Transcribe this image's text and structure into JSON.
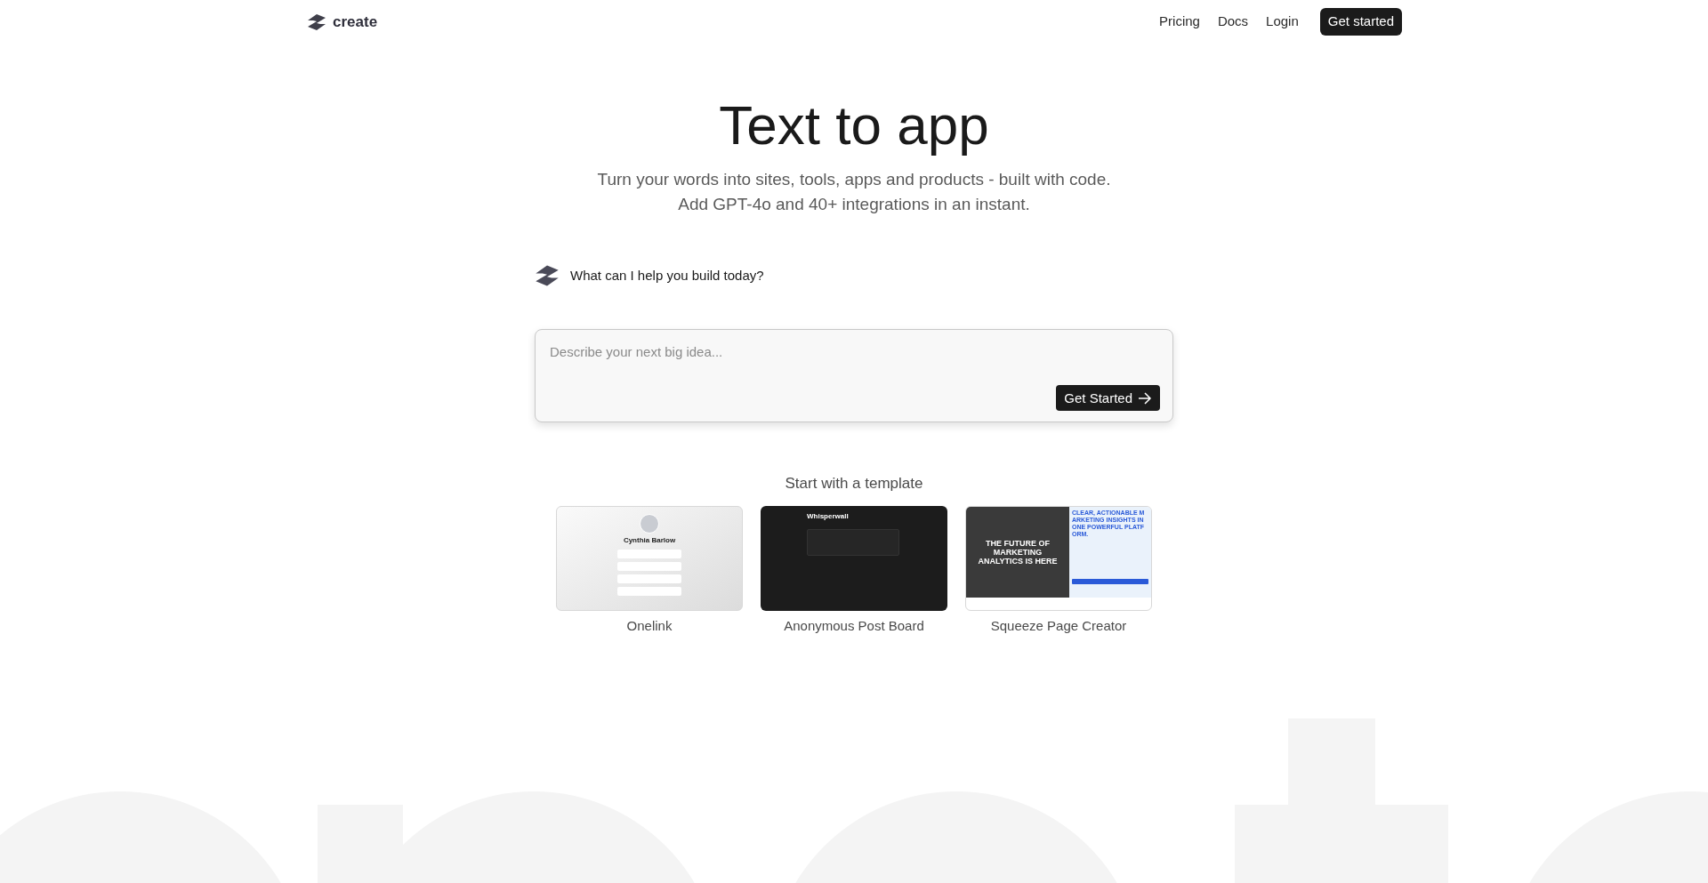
{
  "header": {
    "logo_text": "create",
    "nav": [
      {
        "label": "Pricing"
      },
      {
        "label": "Docs"
      },
      {
        "label": "Login"
      }
    ],
    "cta": "Get started"
  },
  "hero": {
    "title": "Text to app",
    "subtitle_lines": [
      "Turn your words into sites, tools, apps and products - built with code.",
      "Add GPT-4o and 40+ integrations in an instant."
    ]
  },
  "prompt": {
    "question": "What can I help you build today?",
    "placeholder": "Describe your next big idea...",
    "button": "Get Started"
  },
  "templates": {
    "heading": "Start with a template",
    "items": [
      {
        "kind": "profile",
        "label": "Onelink",
        "thumb_texts": [
          "Cynthia Barlow"
        ]
      },
      {
        "kind": "board",
        "label": "Anonymous Post Board",
        "thumb_texts": [
          "Whisperwall"
        ]
      },
      {
        "kind": "landing",
        "label": "Squeeze Page Creator",
        "thumb_texts": [
          "THE FUTURE OF MARKETING ANALYTICS IS HERE",
          "CLEAR, ACTIONABLE MARKETING INSIGHTS IN ONE POWERFUL PLATFORM."
        ]
      }
    ]
  }
}
